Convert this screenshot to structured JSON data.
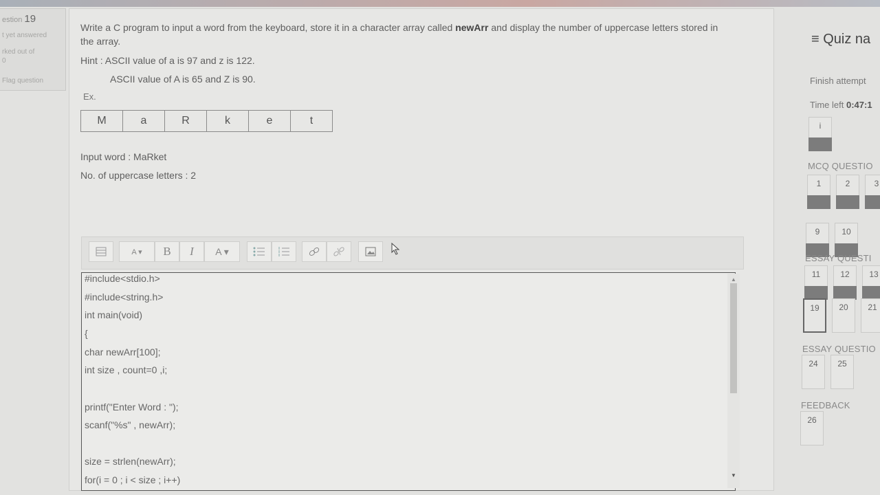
{
  "info": {
    "question_label": "estion",
    "question_number": "19",
    "status": "t yet answered",
    "marked": "rked out of",
    "marked_value": "0",
    "flag": "Flag question"
  },
  "question": {
    "text_before": "Write a C program to input a word from the keyboard, store it in a character array called ",
    "array_name": "newArr",
    "text_after": " and display the number of uppercase letters stored in the array.",
    "hint": "Hint : ASCII value of a is 97 and z is 122.",
    "hint2": "ASCII value of A is 65 and Z is 90.",
    "example_label": "Ex.",
    "array_cells": [
      "M",
      "a",
      "R",
      "k",
      "e",
      "t"
    ],
    "input_word": "Input word : MaRket",
    "uppercase_count": "No. of uppercase letters : 2"
  },
  "toolbar": {
    "bold": "B",
    "italic": "I",
    "font_color": "A ▾",
    "font_size": "A ▾"
  },
  "code_lines": [
    "#include<stdio.h>",
    "#include<string.h>",
    "int main(void)",
    "{",
    "char newArr[100];",
    "int size , count=0 ,i;",
    "",
    "printf(\"Enter Word : \");",
    "scanf(\"%s\" , newArr);",
    "",
    "size = strlen(newArr);",
    "for(i = 0 ; i < size ; i++)"
  ],
  "nav": {
    "title": "≡ Quiz na",
    "finish": "Finish attempt",
    "time_label": "Time left ",
    "time_value": "0:47:1",
    "info_btn": "i",
    "mcq_title": "MCQ QUESTIO",
    "mcq": [
      "1",
      "2",
      "3",
      "9",
      "10"
    ],
    "essay1_title": "ESSAY QUESTI",
    "essay1": [
      "11",
      "12",
      "13",
      "19",
      "20",
      "21"
    ],
    "essay2_title": "ESSAY QUESTIO",
    "essay2": [
      "24",
      "25"
    ],
    "feedback_title": "FEEDBACK",
    "feedback": [
      "26"
    ]
  }
}
